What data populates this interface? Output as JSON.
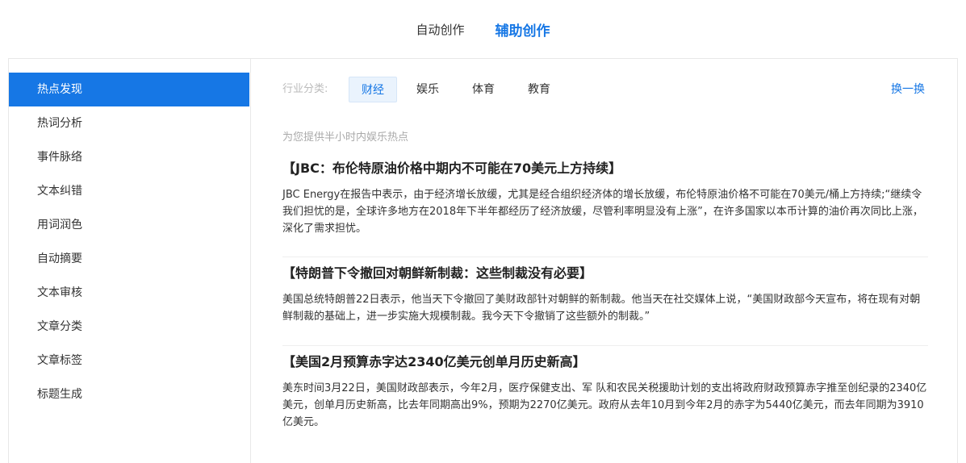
{
  "top_tabs": [
    {
      "label": "自动创作",
      "active": false
    },
    {
      "label": "辅助创作",
      "active": true
    }
  ],
  "sidebar": {
    "items": [
      {
        "label": "热点发现",
        "active": true
      },
      {
        "label": "热词分析"
      },
      {
        "label": "事件脉络"
      },
      {
        "label": "文本纠错"
      },
      {
        "label": "用词润色"
      },
      {
        "label": "自动摘要"
      },
      {
        "label": "文本审核"
      },
      {
        "label": "文章分类"
      },
      {
        "label": "文章标签"
      },
      {
        "label": "标题生成"
      }
    ]
  },
  "filter": {
    "label": "行业分类:",
    "categories": [
      {
        "label": "财经",
        "active": true
      },
      {
        "label": "娱乐"
      },
      {
        "label": "体育"
      },
      {
        "label": "教育"
      }
    ],
    "refresh_label": "换一换"
  },
  "main": {
    "subtitle": "为您提供半小时内娱乐热点",
    "articles": [
      {
        "title": "【JBC：布伦特原油价格中期内不可能在70美元上方持续】",
        "body": "JBC Energy在报告中表示，由于经济增长放缓，尤其是经合组织经济体的增长放缓，布伦特原油价格不可能在70美元/桶上方持续;“继续令我们担忧的是，全球许多地方在2018年下半年都经历了经济放缓，尽管利率明显没有上涨”，在许多国家以本币计算的油价再次同比上涨，深化了需求担忧。"
      },
      {
        "title": "【特朗普下令撤回对朝鲜新制裁：这些制裁没有必要】",
        "body": "美国总统特朗普22日表示，他当天下令撤回了美财政部针对朝鲜的新制裁。他当天在社交媒体上说，“美国财政部今天宣布，将在现有对朝鲜制裁的基础上，进一步实施大规模制裁。我今天下令撤销了这些额外的制裁。”"
      },
      {
        "title": "【美国2月预算赤字达2340亿美元创单月历史新高】",
        "body": "美东时间3月22日，美国财政部表示，今年2月，医疗保健支出、军 队和农民关税援助计划的支出将政府财政预算赤字推至创纪录的2340亿美元，创单月历史新高，比去年同期高出9%，预期为2270亿美元。政府从去年10月到今年2月的赤字为5440亿美元，而去年同期为3910亿美元。"
      }
    ]
  },
  "colors": {
    "accent": "#1677e5",
    "active_chip_bg": "#eaf3fd",
    "border": "#e8e8e8"
  }
}
